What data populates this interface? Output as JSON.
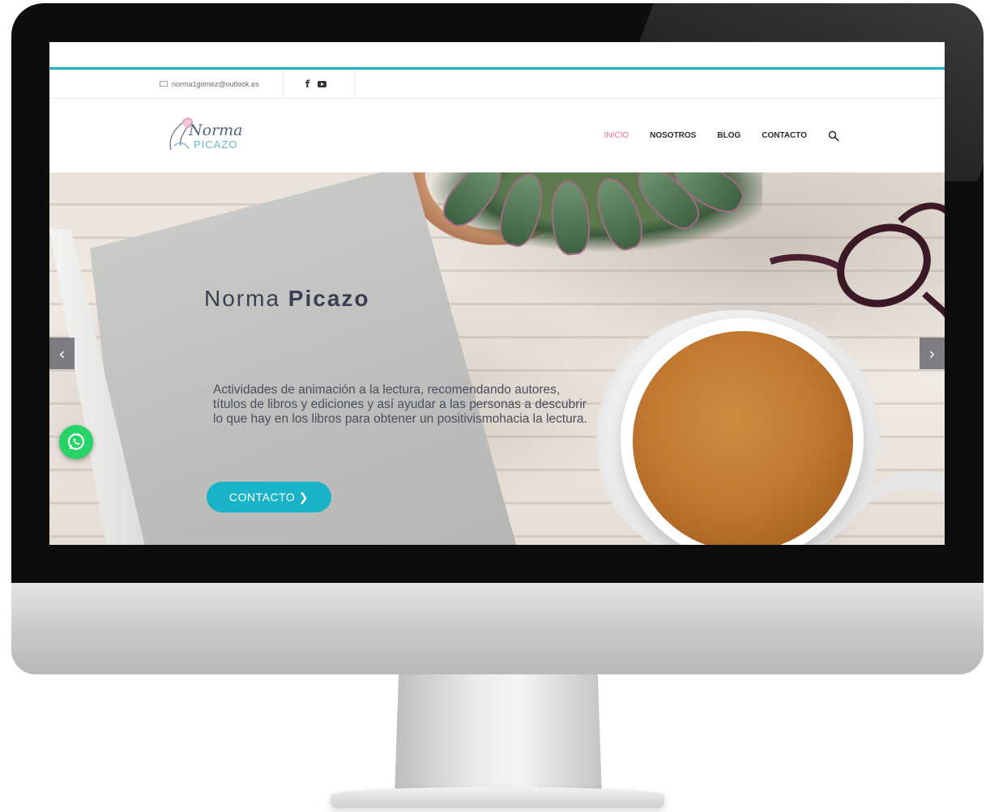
{
  "topbar": {
    "email": "norma1gomez@outlook.es",
    "social": {
      "facebook_icon": "facebook-icon",
      "youtube_icon": "youtube-icon"
    }
  },
  "header": {
    "logo": {
      "line1": "Norma",
      "line2": "PICAZO"
    },
    "nav": [
      {
        "label": "INICIO",
        "active": true
      },
      {
        "label": "NOSOTROS",
        "active": false
      },
      {
        "label": "BLOG",
        "active": false
      },
      {
        "label": "CONTACTO",
        "active": false
      }
    ],
    "search_icon": "search-icon"
  },
  "hero": {
    "title_first": "Norma",
    "title_last": "Picazo",
    "description": "Actividades de animación a la lectura, recomendando autores, títulos de libros y ediciones y así ayudar a las personas a descubrir lo que hay en los libros para obtener un positivismohacia la lectura.",
    "cta_label": "CONTACTO ❯",
    "prev_arrow": "‹",
    "next_arrow": "›"
  },
  "colors": {
    "accent": "#1ab3c8",
    "nav_active": "#e0708a",
    "whatsapp": "#25d366"
  }
}
